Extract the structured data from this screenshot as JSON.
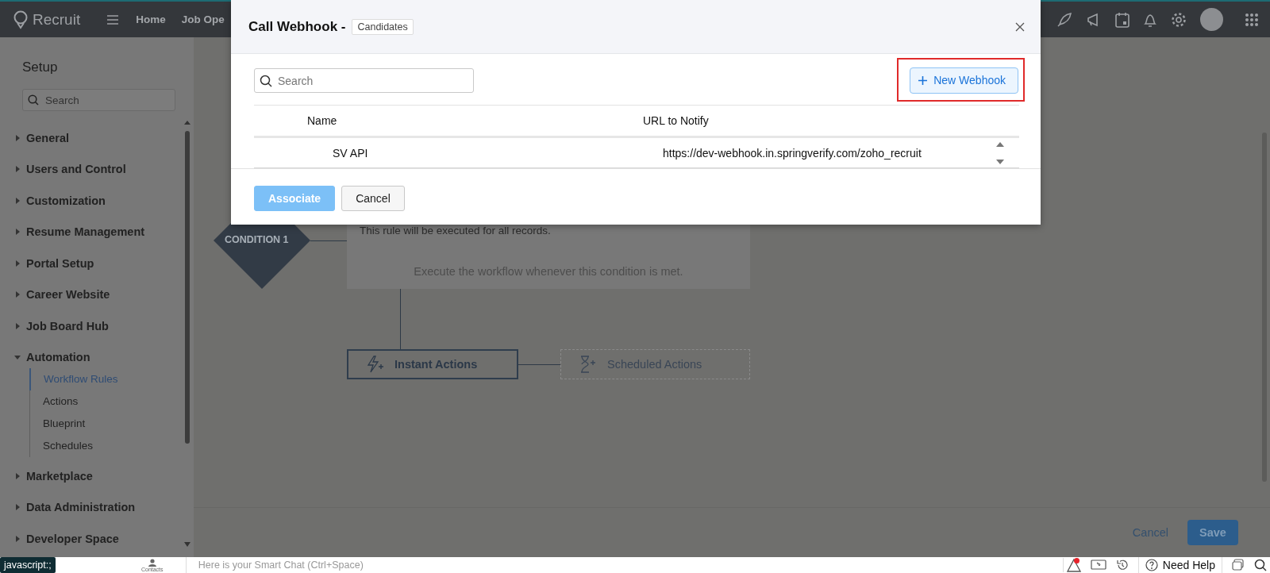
{
  "topbar": {
    "app_name": "Recruit",
    "nav": [
      {
        "label": "Home"
      },
      {
        "label": "Job Ope"
      }
    ]
  },
  "sidebar": {
    "title": "Setup",
    "search": {
      "placeholder": "Search"
    },
    "items": [
      {
        "label": "General",
        "expanded": false
      },
      {
        "label": "Users and Control",
        "expanded": false
      },
      {
        "label": "Customization",
        "expanded": false
      },
      {
        "label": "Resume Management",
        "expanded": false
      },
      {
        "label": "Portal Setup",
        "expanded": false
      },
      {
        "label": "Career Website",
        "expanded": false
      },
      {
        "label": "Job Board Hub",
        "expanded": false
      },
      {
        "label": "Automation",
        "expanded": true,
        "children": [
          {
            "label": "Workflow Rules",
            "selected": true
          },
          {
            "label": "Actions",
            "selected": false
          },
          {
            "label": "Blueprint",
            "selected": false
          },
          {
            "label": "Schedules",
            "selected": false
          }
        ]
      },
      {
        "label": "Marketplace",
        "expanded": false
      },
      {
        "label": "Data Administration",
        "expanded": false
      },
      {
        "label": "Developer Space",
        "expanded": false
      }
    ]
  },
  "canvas": {
    "condition": {
      "label": "CONDITION 1",
      "summary": "This rule will be executed for all records.",
      "hint": "Execute the workflow whenever this condition is met."
    },
    "actions": [
      {
        "kind": "instant",
        "label": "Instant Actions"
      },
      {
        "kind": "scheduled",
        "label": "Scheduled Actions"
      }
    ],
    "cancel": "Cancel",
    "save": "Save"
  },
  "modal": {
    "title": "Call Webhook -",
    "module_tag": "Candidates",
    "search": {
      "placeholder": "Search"
    },
    "new_button": "New Webhook",
    "new_button_highlighted": true,
    "columns": [
      "Name",
      "URL to Notify"
    ],
    "rows": [
      {
        "name": "SV API",
        "url": "https://dev-webhook.in.springverify.com/zoho_recruit"
      }
    ],
    "buttons": [
      {
        "label": "Associate",
        "primary": true
      },
      {
        "label": "Cancel",
        "primary": false
      }
    ]
  },
  "bottombar": {
    "link_tooltip": "javascript:;",
    "contacts_label": "Contacts",
    "chat_placeholder": "Here is your Smart Chat (Ctrl+Space)",
    "alert_badge": true,
    "help_label": "Need Help"
  }
}
